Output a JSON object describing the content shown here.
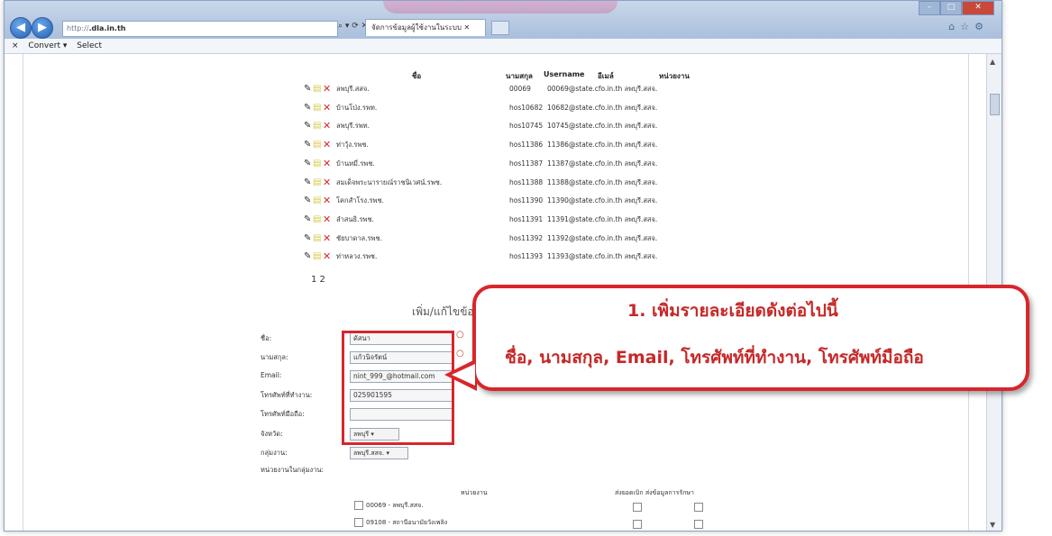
{
  "browser": {
    "address_url": "http://",
    "address_domain": ".dla.in.th",
    "tab_title": "จัดการข้อมูลผู้ใช้งานในระบบ",
    "toolbar_convert": "Convert",
    "toolbar_select": "Select"
  },
  "table": {
    "headers": [
      "ชื่อ",
      "นามสกุล",
      "Username",
      "อีเมล์",
      "หน่วยงาน"
    ],
    "rows": [
      {
        "name": "ลพบุรี.สสจ.",
        "username": "00069",
        "email": "00069@state.cfo.in.th ลพบุรี.สสจ."
      },
      {
        "name": "บ้านโป่ง.รพท.",
        "username": "hos10682",
        "email": "10682@state.cfo.in.th ลพบุรี.สสจ."
      },
      {
        "name": "ลพบุรี.รพท.",
        "username": "hos10745",
        "email": "10745@state.cfo.in.th ลพบุรี.สสจ."
      },
      {
        "name": "ท่าวุ้ง.รพช.",
        "username": "hos11386",
        "email": "11386@state.cfo.in.th ลพบุรี.สสจ."
      },
      {
        "name": "บ้านหมี่.รพช.",
        "username": "hos11387",
        "email": "11387@state.cfo.in.th ลพบุรี.สสจ."
      },
      {
        "name": "สมเด็จพระนารายณ์ราชนิเวศน์.รพช.",
        "username": "hos11388",
        "email": "11388@state.cfo.in.th ลพบุรี.สสจ."
      },
      {
        "name": "โคกสำโรง.รพช.",
        "username": "hos11390",
        "email": "11390@state.cfo.in.th ลพบุรี.สสจ."
      },
      {
        "name": "ลำสนธิ.รพช.",
        "username": "hos11391",
        "email": "11391@state.cfo.in.th ลพบุรี.สสจ."
      },
      {
        "name": "ชัยบาดาล.รพช.",
        "username": "hos11392",
        "email": "11392@state.cfo.in.th ลพบุรี.สสจ."
      },
      {
        "name": "ท่าหลวง.รพช.",
        "username": "hos11393",
        "email": "11393@state.cfo.in.th ลพบุรี.สสจ."
      }
    ],
    "pager": "1 2"
  },
  "form": {
    "title": "เพิ่ม/แก้ไขข้อมูลผู้ใช้งาน",
    "labels": {
      "first_name": "ชื่อ:",
      "last_name": "นามสกุล:",
      "email": "Email:",
      "work_phone": "โทรศัพท์ที่ทำงาน:",
      "mobile": "โทรศัพท์มือถือ:",
      "province": "จังหวัด:",
      "group": "กลุ่มงาน:",
      "units": "หน่วยงานในกลุ่มงาน:"
    },
    "values": {
      "first_name": "ดัสนา",
      "last_name": "แก้วนิจรัตน์",
      "email": "nint_999_@hotmail.com",
      "work_phone": "025901595",
      "mobile": ""
    },
    "province_value": "ลพบุรี",
    "group_value": "ลพบุรี.สสจ.",
    "unit_header": "หน่วยงาน",
    "col_header_right": "ส่งยอดเบิก ส่งข้อมูลการรักษา",
    "units": [
      "00069 - ลพบุรี.สสจ.",
      "09108 - สถานีอนามัยวังเพลิง"
    ]
  },
  "callout": {
    "line1": "1. เพิ่มรายละเอียดดังต่อไปนี้",
    "line2": "ชื่อ, นามสกุล, Email, โทรศัพท์ที่ทำงาน, โทรศัพท์มือถือ"
  }
}
